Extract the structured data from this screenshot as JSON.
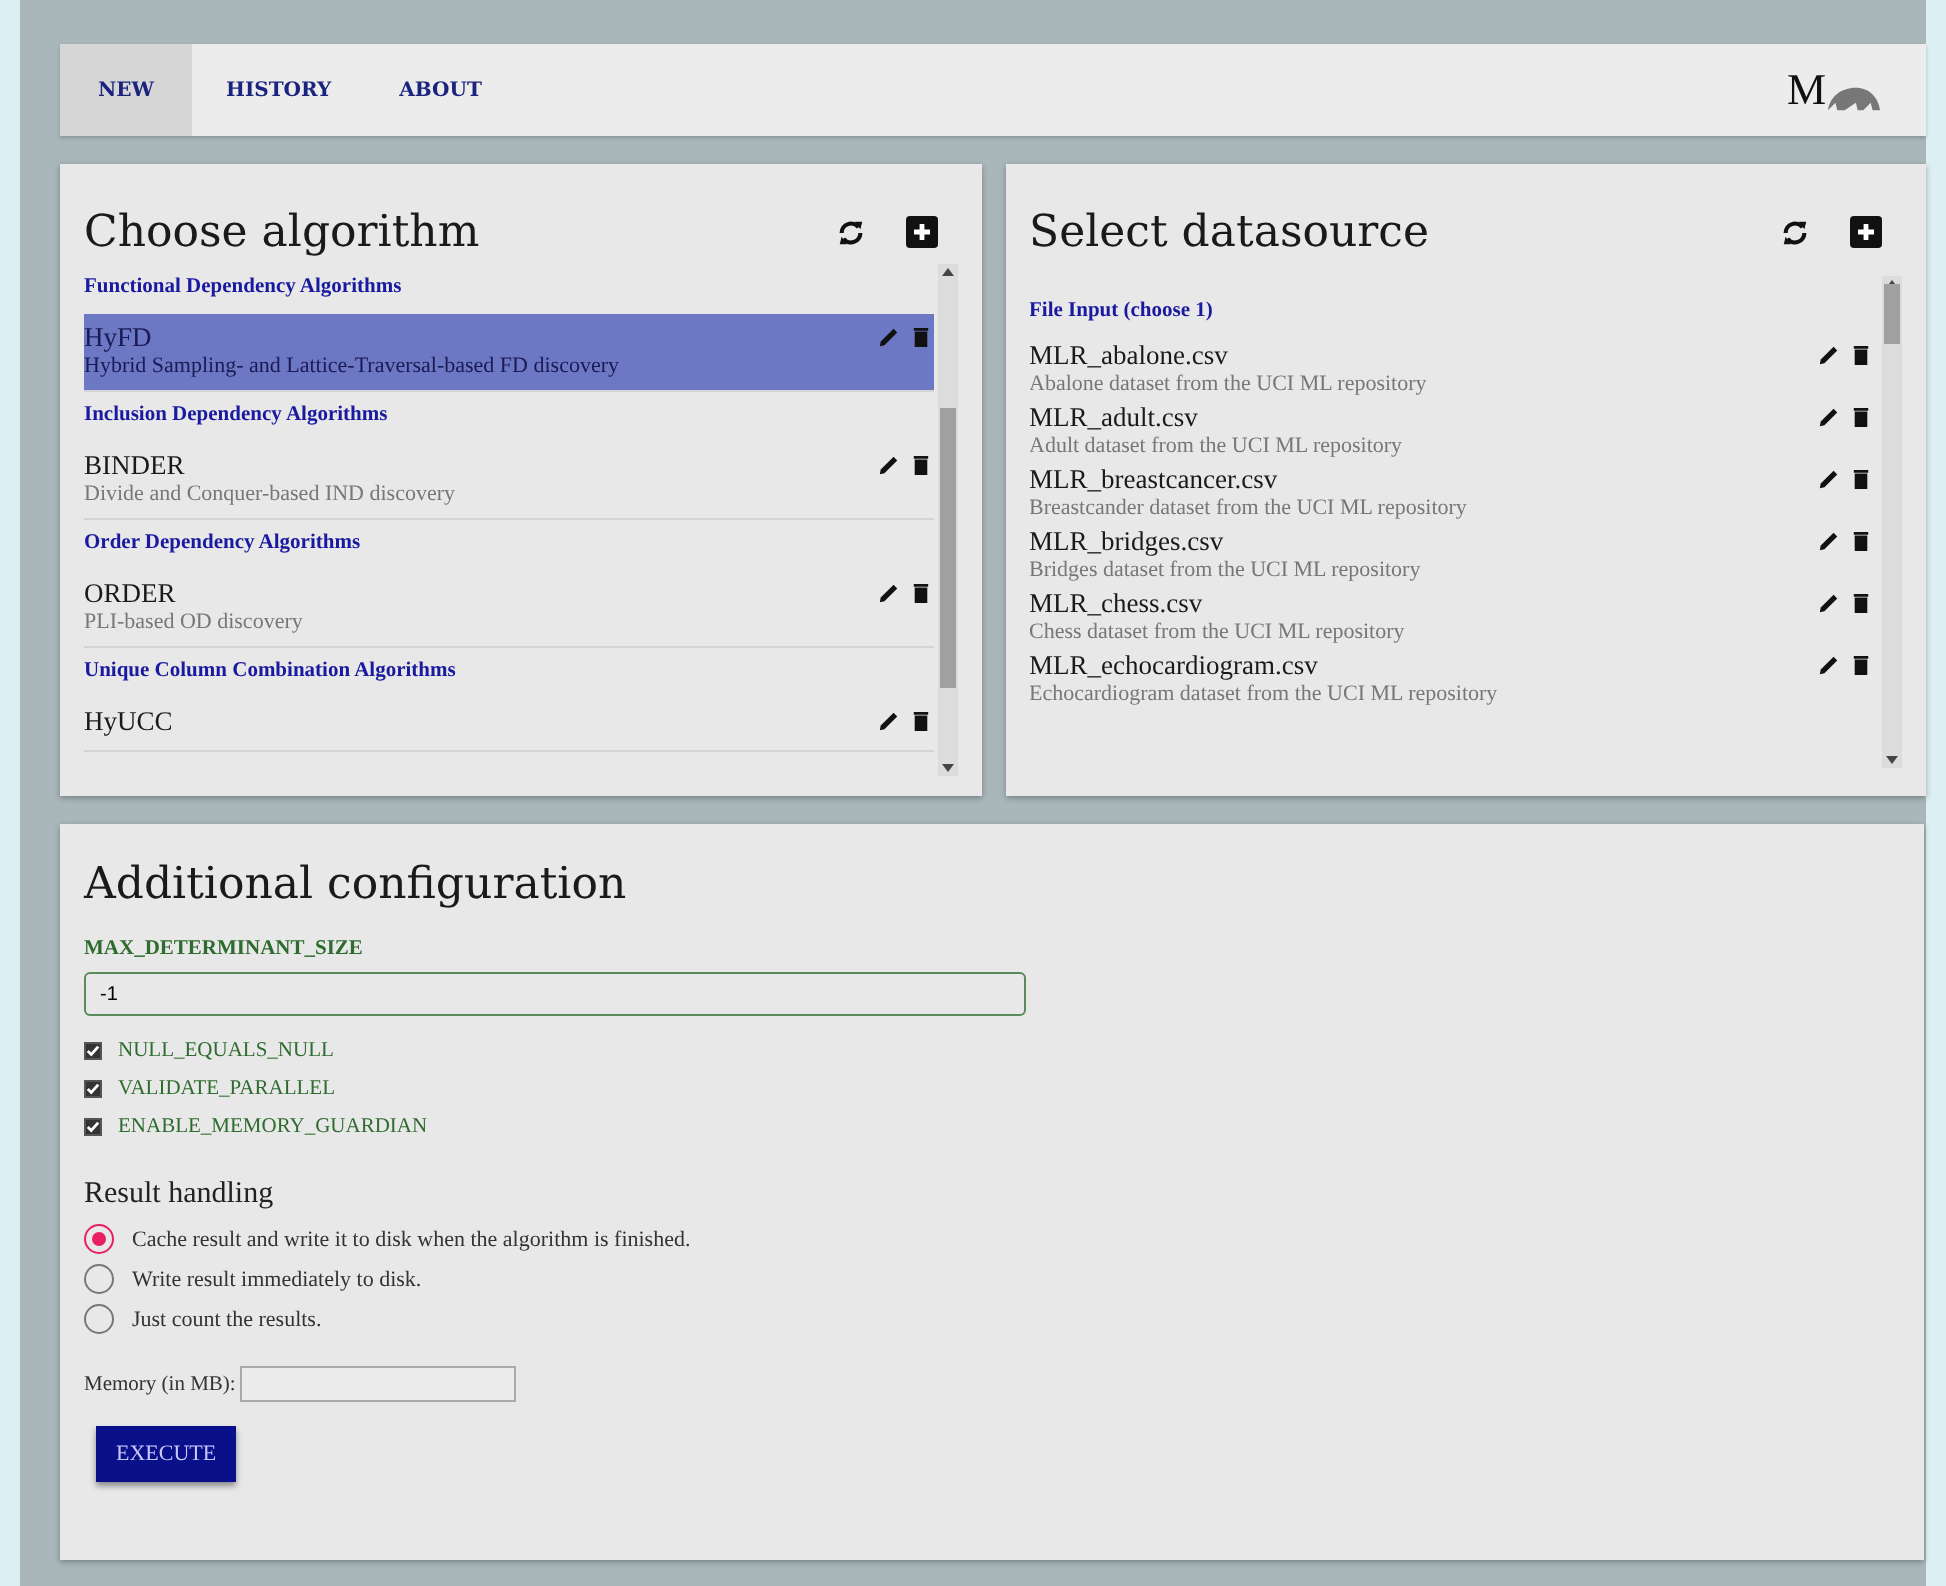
{
  "nav": {
    "tabs": [
      {
        "label": "NEW",
        "selected": true
      },
      {
        "label": "HISTORY",
        "selected": false
      },
      {
        "label": "ABOUT",
        "selected": false
      }
    ],
    "logo": "M"
  },
  "algorithms": {
    "title": "Choose algorithm",
    "groups": [
      {
        "name": "Functional Dependency Algorithms",
        "items": [
          {
            "name": "HyFD",
            "description": "Hybrid Sampling- and Lattice-Traversal-based FD discovery",
            "selected": true
          }
        ]
      },
      {
        "name": "Inclusion Dependency Algorithms",
        "items": [
          {
            "name": "BINDER",
            "description": "Divide and Conquer-based IND discovery",
            "selected": false
          }
        ]
      },
      {
        "name": "Order Dependency Algorithms",
        "items": [
          {
            "name": "ORDER",
            "description": "PLI-based OD discovery",
            "selected": false
          }
        ]
      },
      {
        "name": "Unique Column Combination Algorithms",
        "items": [
          {
            "name": "HyUCC",
            "selected": false
          }
        ]
      }
    ]
  },
  "datasources": {
    "title": "Select datasource",
    "groups": [
      {
        "name": "File Input (choose 1)",
        "items": [
          {
            "name": "MLR_abalone.csv",
            "description": "Abalone dataset from the UCI ML repository",
            "selected": false
          },
          {
            "name": "MLR_adult.csv",
            "description": "Adult dataset from the UCI ML repository",
            "selected": false
          },
          {
            "name": "MLR_breastcancer.csv",
            "description": "Breastcander dataset from the UCI ML repository",
            "selected": false
          },
          {
            "name": "MLR_bridges.csv",
            "description": "Bridges dataset from the UCI ML repository",
            "selected": false
          },
          {
            "name": "MLR_chess.csv",
            "description": "Chess dataset from the UCI ML repository",
            "selected": false
          },
          {
            "name": "MLR_echocardiogram.csv",
            "description": "Echocardiogram dataset from the UCI ML repository",
            "selected": false
          }
        ]
      }
    ]
  },
  "config": {
    "title": "Additional configuration",
    "parameters": [
      {
        "kind": "text",
        "label": "MAX_DETERMINANT_SIZE",
        "value": "-1"
      },
      {
        "kind": "checkbox",
        "label": "NULL_EQUALS_NULL",
        "checked": true
      },
      {
        "kind": "checkbox",
        "label": "VALIDATE_PARALLEL",
        "checked": true
      },
      {
        "kind": "checkbox",
        "label": "ENABLE_MEMORY_GUARDIAN",
        "checked": true
      }
    ],
    "result_title": "Result handling",
    "result_options": [
      {
        "label": "Cache result and write it to disk when the algorithm is finished.",
        "selected": true
      },
      {
        "label": "Write result immediately to disk.",
        "selected": false
      },
      {
        "label": "Just count the results.",
        "selected": false
      }
    ],
    "memory_label": "Memory (in MB):",
    "execute": "EXECUTE"
  }
}
